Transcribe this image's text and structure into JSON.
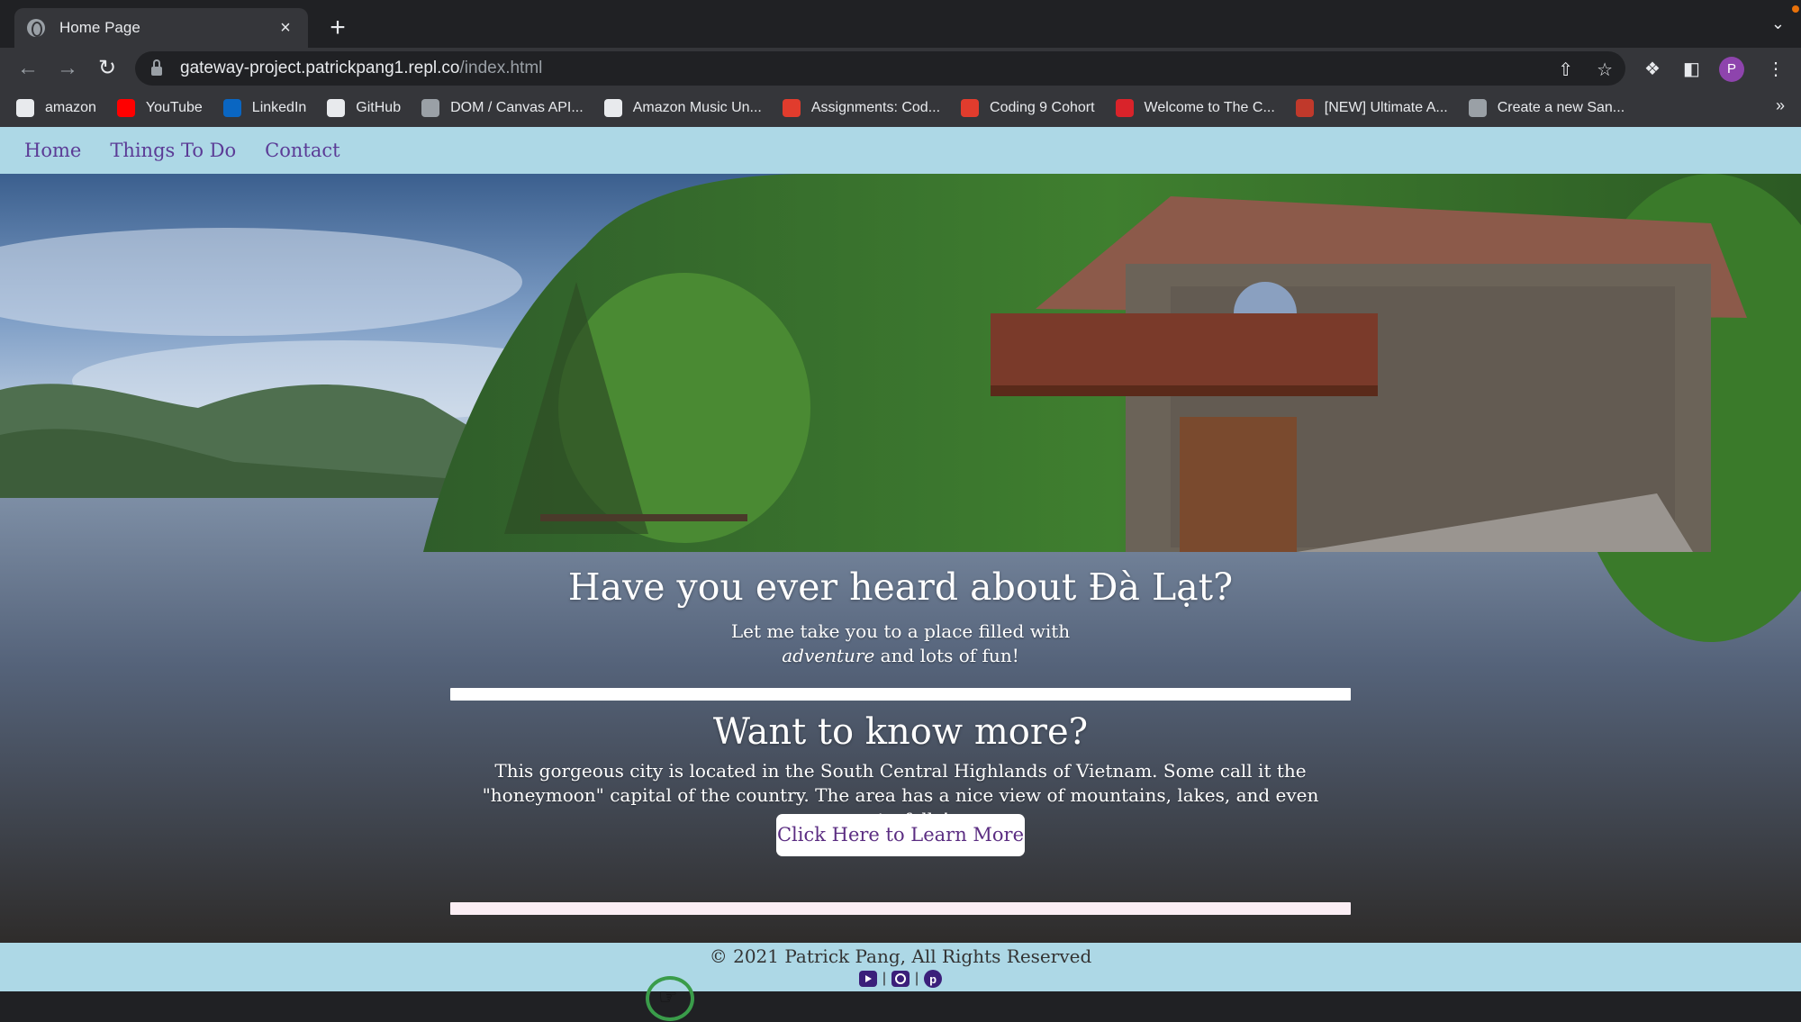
{
  "browser": {
    "tab_title": "Home Page",
    "tab_close": "×",
    "new_tab": "+",
    "url_host": "gateway-project.patrickpang1.repl.co",
    "url_path": "/index.html",
    "profile_initial": "P"
  },
  "bookmarks": [
    {
      "label": "amazon",
      "icon": "amazon-icon",
      "color": "#ffffff"
    },
    {
      "label": "YouTube",
      "icon": "youtube-icon",
      "color": "#ff0000"
    },
    {
      "label": "LinkedIn",
      "icon": "linkedin-icon",
      "color": "#0a66c2"
    },
    {
      "label": "GitHub",
      "icon": "github-icon",
      "color": "#ffffff"
    },
    {
      "label": "DOM / Canvas API...",
      "icon": "document-icon",
      "color": "#9aa0a6"
    },
    {
      "label": "Amazon Music Un...",
      "icon": "amazon-icon",
      "color": "#ffffff"
    },
    {
      "label": "Assignments: Cod...",
      "icon": "canvas-icon",
      "color": "#e13c2d"
    },
    {
      "label": "Coding 9 Cohort",
      "icon": "canvas-icon",
      "color": "#e13c2d"
    },
    {
      "label": "Welcome to The C...",
      "icon": "rv-icon",
      "color": "#d9232a"
    },
    {
      "label": "[NEW] Ultimate A...",
      "icon": "target-icon",
      "color": "#c0392b"
    },
    {
      "label": "Create a new San...",
      "icon": "box-icon",
      "color": "#9aa0a6"
    }
  ],
  "nav": {
    "home": "Home",
    "things": "Things To Do",
    "contact": "Contact"
  },
  "hero": {
    "title": "Have you ever heard about Đà Lạt?",
    "subtitle_line1": "Let me take you to a place filled with",
    "subtitle_em": "adventure",
    "subtitle_rest": " and lots of fun!",
    "title2": "Want to know more?",
    "body": "This gorgeous city is located in the South Central Highlands of Vietnam. Some call it the \"honeymoon\" capital of the country. The area has a nice view of mountains, lakes, and even waterfalls!",
    "cta": "Click Here to Learn More"
  },
  "footer": {
    "copyright": "© 2021 Patrick Pang, All Rights Reserved",
    "separator": "|"
  },
  "colors": {
    "nav_bg": "#add8e6",
    "nav_link": "#5b3b96",
    "cta_text": "#5b2d82"
  }
}
